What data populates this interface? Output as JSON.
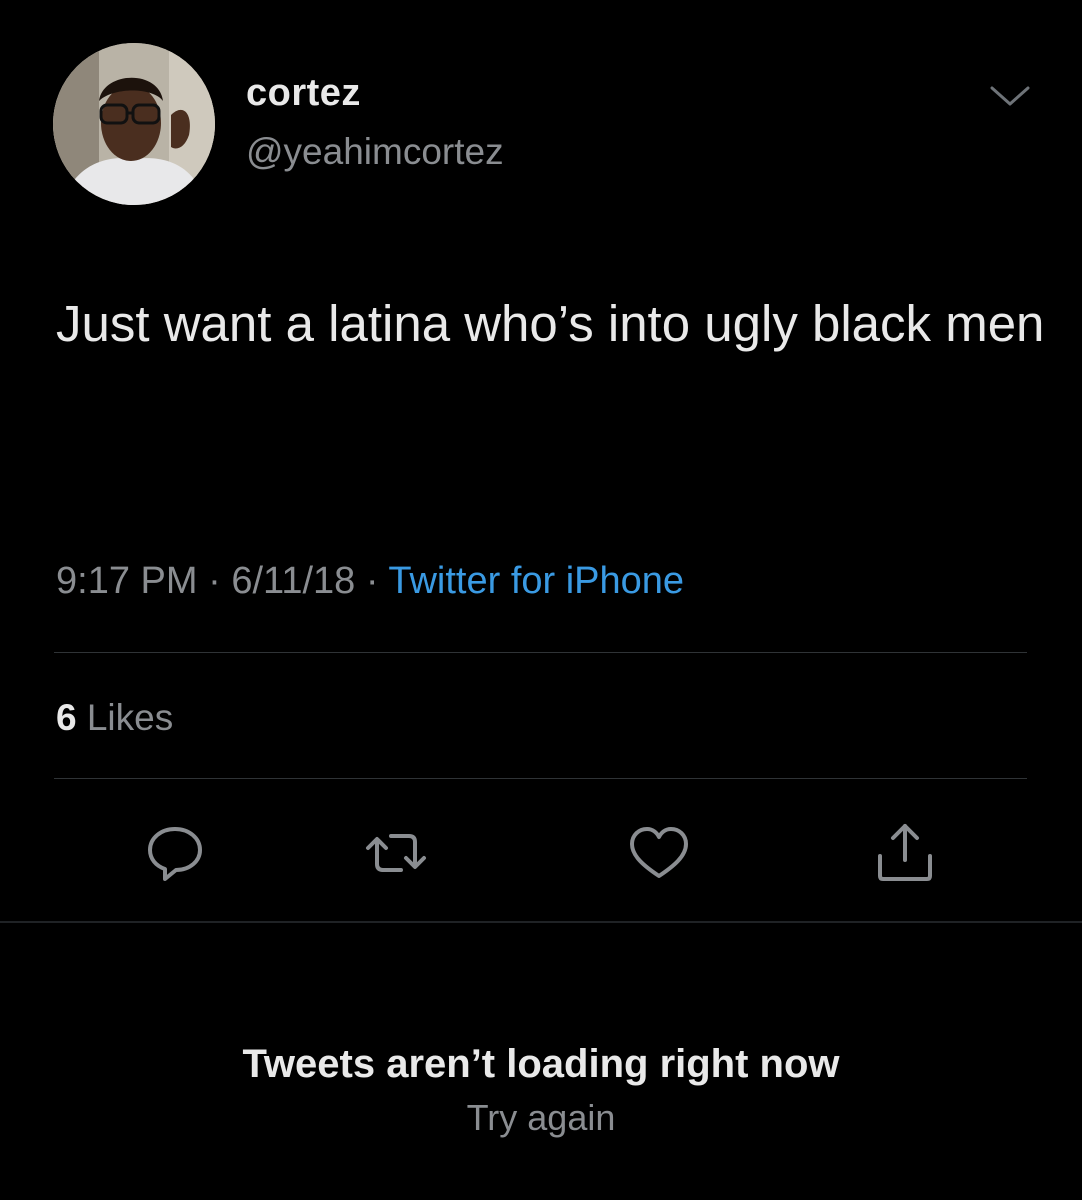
{
  "tweet": {
    "author": {
      "display_name": "cortez",
      "handle": "@yeahimcortez"
    },
    "text": "Just want a latina who’s into ugly black men",
    "time": "9:17 PM",
    "separator": "·",
    "date": "6/11/18",
    "source": "Twitter for iPhone",
    "likes_count": "6",
    "likes_label": "Likes"
  },
  "actions": [
    {
      "name": "reply-icon"
    },
    {
      "name": "retweet-icon"
    },
    {
      "name": "like-icon"
    },
    {
      "name": "share-icon"
    }
  ],
  "empty_state": {
    "title": "Tweets aren’t loading right now",
    "retry": "Try again"
  },
  "colors": {
    "background": "#000000",
    "text_primary": "#e9e9e9",
    "text_secondary": "#8a8d91",
    "link": "#3a9ae3",
    "divider": "#2f3336"
  }
}
